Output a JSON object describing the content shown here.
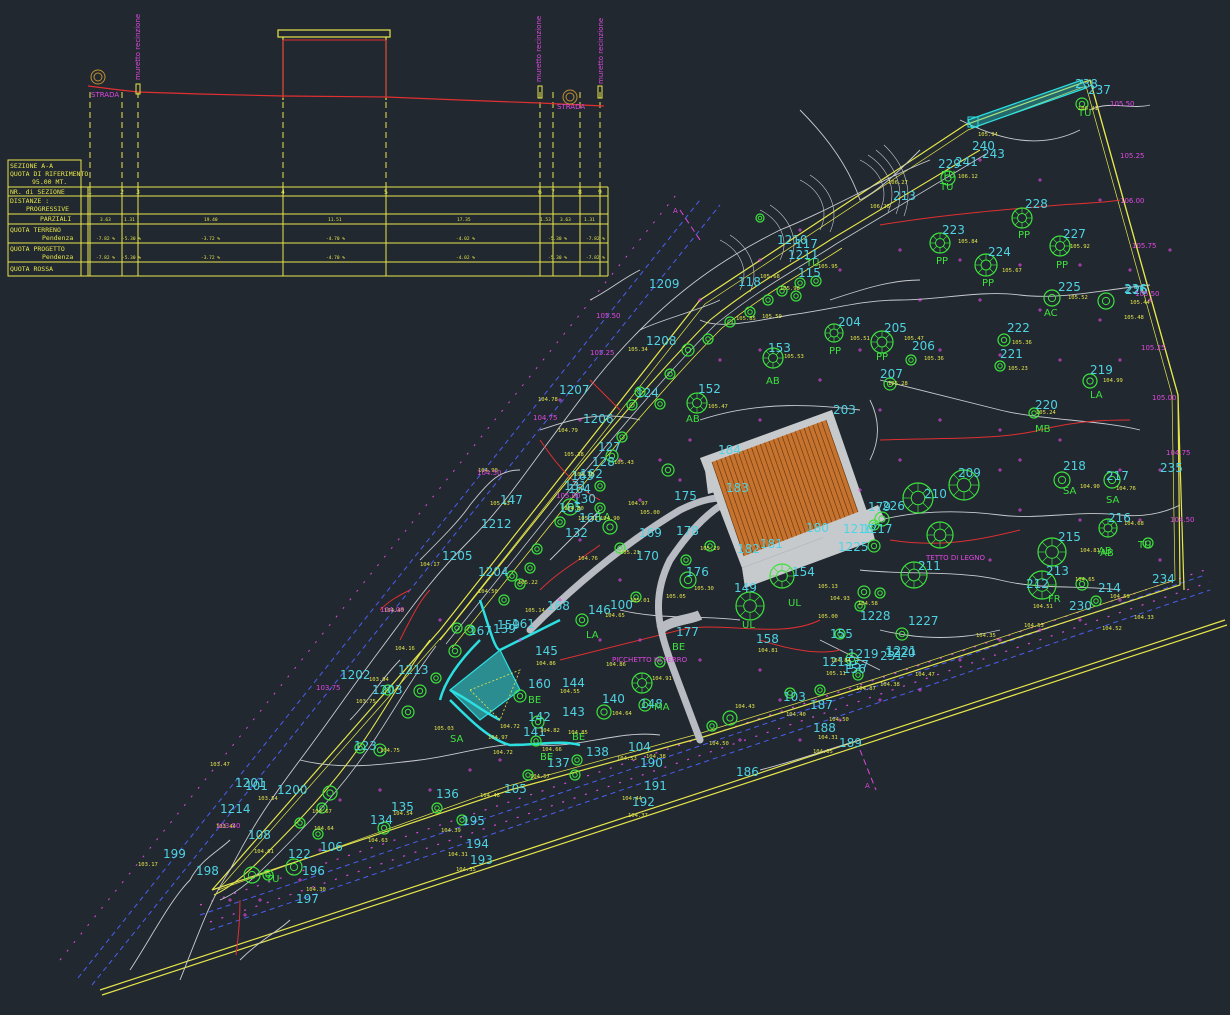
{
  "colors": {
    "background": "#212830",
    "yellow": "#e6e64a",
    "cyan": "#4fd3e3",
    "green": "#3ee23e",
    "magenta": "#e048e0",
    "red": "#e03030",
    "blue": "#4b5ef0",
    "gray": "#c9ccd0",
    "building": "#c5732e"
  },
  "section": {
    "table_rows": [
      "SEZIONE A-A",
      "QUOTA DI RIFERIMENTO",
      "95.00 MT.",
      "NR. di SEZIONE",
      "DISTANZE :",
      "PROGRESSIVE",
      "PARZIALI",
      "QUOTA TERRENO",
      "Pendenza",
      "QUOTA PROGETTO",
      "Pendenza",
      "QUOTA ROSSA"
    ],
    "section_numbers": [
      "1",
      "2",
      "3",
      "4",
      "5",
      "6",
      "7",
      "8",
      "9"
    ],
    "labels_top": [
      "muretto recinzione",
      "muretto recinzione",
      "muretto recinzione"
    ],
    "strada_labels": [
      "STRADA",
      "STRADA"
    ],
    "partial_distances": [
      "3.63",
      "1.31",
      "19.40",
      "11.51",
      "17.35",
      "1.53",
      "3.63",
      "1.31"
    ],
    "slopes_terrain": [
      "-7.82 %",
      "-5.30 %",
      "-3.72 %",
      "-4.70 %",
      "-4.02 %",
      "-5.30 %",
      "-7.82 %"
    ],
    "slopes_project": [
      "-7.82 %",
      "-5.30 %",
      "-3.72 %",
      "-4.70 %",
      "-4.02 %",
      "-5.30 %",
      "-7.82 %"
    ]
  },
  "plan": {
    "point_labels": [
      {
        "t": "238"
      },
      {
        "t": "237"
      },
      {
        "t": "240"
      },
      {
        "t": "241"
      },
      {
        "t": "229"
      },
      {
        "t": "243"
      },
      {
        "t": "213"
      },
      {
        "t": "228"
      },
      {
        "t": "223"
      },
      {
        "t": "227"
      },
      {
        "t": "224"
      },
      {
        "t": "225"
      },
      {
        "t": "226"
      },
      {
        "t": "222"
      },
      {
        "t": "221"
      },
      {
        "t": "204"
      },
      {
        "t": "205"
      },
      {
        "t": "206"
      },
      {
        "t": "207"
      },
      {
        "t": "219"
      },
      {
        "t": "220"
      },
      {
        "t": "203"
      },
      {
        "t": "153"
      },
      {
        "t": "152"
      },
      {
        "t": "1210"
      },
      {
        "t": "1211"
      },
      {
        "t": "1209"
      },
      {
        "t": "1208"
      },
      {
        "t": "1207"
      },
      {
        "t": "1206"
      },
      {
        "t": "1212"
      },
      {
        "t": "1205"
      },
      {
        "t": "1204"
      },
      {
        "t": "1203"
      },
      {
        "t": "1202"
      },
      {
        "t": "1201"
      },
      {
        "t": "1200"
      },
      {
        "t": "1214"
      },
      {
        "t": "1213"
      },
      {
        "t": "218"
      },
      {
        "t": "217"
      },
      {
        "t": "216"
      },
      {
        "t": "215"
      },
      {
        "t": "213"
      },
      {
        "t": "214"
      },
      {
        "t": "212"
      },
      {
        "t": "230"
      },
      {
        "t": "231"
      },
      {
        "t": "234"
      },
      {
        "t": "235"
      },
      {
        "t": "209"
      },
      {
        "t": "210"
      },
      {
        "t": "211"
      },
      {
        "t": "226"
      },
      {
        "t": "1227"
      },
      {
        "t": "1228"
      },
      {
        "t": "1219"
      },
      {
        "t": "1220"
      },
      {
        "t": "1221"
      },
      {
        "t": "1215"
      },
      {
        "t": "1216"
      },
      {
        "t": "1217"
      },
      {
        "t": "1225"
      },
      {
        "t": "180"
      },
      {
        "t": "181"
      },
      {
        "t": "182"
      },
      {
        "t": "183"
      },
      {
        "t": "184"
      },
      {
        "t": "178"
      },
      {
        "t": "177"
      },
      {
        "t": "176"
      },
      {
        "t": "175"
      },
      {
        "t": "170"
      },
      {
        "t": "169"
      },
      {
        "t": "168"
      },
      {
        "t": "167"
      },
      {
        "t": "166"
      },
      {
        "t": "165"
      },
      {
        "t": "164"
      },
      {
        "t": "163"
      },
      {
        "t": "162"
      },
      {
        "t": "161"
      },
      {
        "t": "160"
      },
      {
        "t": "159"
      },
      {
        "t": "158"
      },
      {
        "t": "155"
      },
      {
        "t": "154"
      },
      {
        "t": "149"
      },
      {
        "t": "148"
      },
      {
        "t": "147"
      },
      {
        "t": "146"
      },
      {
        "t": "145"
      },
      {
        "t": "144"
      },
      {
        "t": "143"
      },
      {
        "t": "142"
      },
      {
        "t": "141"
      },
      {
        "t": "140"
      },
      {
        "t": "139"
      },
      {
        "t": "138"
      },
      {
        "t": "137"
      },
      {
        "t": "136"
      },
      {
        "t": "135"
      },
      {
        "t": "134"
      },
      {
        "t": "132"
      },
      {
        "t": "131"
      },
      {
        "t": "130"
      },
      {
        "t": "128"
      },
      {
        "t": "127"
      },
      {
        "t": "124"
      },
      {
        "t": "123"
      },
      {
        "t": "122"
      },
      {
        "t": "118"
      },
      {
        "t": "117"
      },
      {
        "t": "115"
      },
      {
        "t": "108"
      },
      {
        "t": "106"
      },
      {
        "t": "105"
      },
      {
        "t": "104"
      },
      {
        "t": "100"
      },
      {
        "t": "199"
      },
      {
        "t": "198"
      },
      {
        "t": "197"
      },
      {
        "t": "196"
      },
      {
        "t": "195"
      },
      {
        "t": "194"
      },
      {
        "t": "193"
      },
      {
        "t": "192"
      },
      {
        "t": "191"
      },
      {
        "t": "190"
      },
      {
        "t": "189"
      },
      {
        "t": "188"
      },
      {
        "t": "187"
      },
      {
        "t": "186"
      },
      {
        "t": "156"
      },
      {
        "t": "157"
      },
      {
        "t": "179"
      },
      {
        "t": "236"
      },
      {
        "t": "103"
      },
      {
        "t": "101"
      }
    ],
    "species_labels": [
      {
        "t": "TU"
      },
      {
        "t": "TU"
      },
      {
        "t": "PP"
      },
      {
        "t": "PP"
      },
      {
        "t": "PP"
      },
      {
        "t": "PP"
      },
      {
        "t": "AC"
      },
      {
        "t": "AB"
      },
      {
        "t": "PP"
      },
      {
        "t": "PP"
      },
      {
        "t": "AB"
      },
      {
        "t": "AB"
      },
      {
        "t": "LA"
      },
      {
        "t": "MB"
      },
      {
        "t": "SA"
      },
      {
        "t": "SA"
      },
      {
        "t": "AB"
      },
      {
        "t": "TU"
      },
      {
        "t": "LA"
      },
      {
        "t": "LA"
      },
      {
        "t": "BE"
      },
      {
        "t": "BE"
      },
      {
        "t": "MA"
      },
      {
        "t": "SA"
      },
      {
        "t": "BE"
      },
      {
        "t": "TU"
      },
      {
        "t": "TU"
      },
      {
        "t": "UL"
      },
      {
        "t": "UL"
      },
      {
        "t": "FR"
      },
      {
        "t": "BE"
      },
      {
        "t": "TU"
      }
    ],
    "elevation_labels": [
      {
        "t": "106.41"
      },
      {
        "t": "105.94"
      },
      {
        "t": "106.12"
      },
      {
        "t": "106.27"
      },
      {
        "t": "106.26"
      },
      {
        "t": "105.95"
      },
      {
        "t": "105.84"
      },
      {
        "t": "105.92"
      },
      {
        "t": "105.67"
      },
      {
        "t": "105.52"
      },
      {
        "t": "105.48"
      },
      {
        "t": "105.44"
      },
      {
        "t": "105.36"
      },
      {
        "t": "105.23"
      },
      {
        "t": "105.51"
      },
      {
        "t": "105.47"
      },
      {
        "t": "105.36"
      },
      {
        "t": "105.28"
      },
      {
        "t": "104.99"
      },
      {
        "t": "105.24"
      },
      {
        "t": "105.53"
      },
      {
        "t": "105.47"
      },
      {
        "t": "105.98"
      },
      {
        "t": "105.85"
      },
      {
        "t": "105.68"
      },
      {
        "t": "105.59"
      },
      {
        "t": "105.34"
      },
      {
        "t": "104.79"
      },
      {
        "t": "105.38"
      },
      {
        "t": "105.43"
      },
      {
        "t": "104.78"
      },
      {
        "t": "104.17"
      },
      {
        "t": "104.90"
      },
      {
        "t": "104.50"
      },
      {
        "t": "104.40"
      },
      {
        "t": "104.16"
      },
      {
        "t": "103.94"
      },
      {
        "t": "103.75"
      },
      {
        "t": "103.47"
      },
      {
        "t": "103.54"
      },
      {
        "t": "103.44"
      },
      {
        "t": "103.17"
      },
      {
        "t": "104.90"
      },
      {
        "t": "104.76"
      },
      {
        "t": "104.68"
      },
      {
        "t": "104.81"
      },
      {
        "t": "104.65"
      },
      {
        "t": "104.59"
      },
      {
        "t": "104.53"
      },
      {
        "t": "104.35"
      },
      {
        "t": "104.47"
      },
      {
        "t": "104.38"
      },
      {
        "t": "104.52"
      },
      {
        "t": "104.58"
      },
      {
        "t": "104.93"
      },
      {
        "t": "104.81"
      },
      {
        "t": "105.13"
      },
      {
        "t": "105.30"
      },
      {
        "t": "105.29"
      },
      {
        "t": "105.21"
      },
      {
        "t": "105.05"
      },
      {
        "t": "105.01"
      },
      {
        "t": "104.91"
      },
      {
        "t": "104.86"
      },
      {
        "t": "104.55"
      },
      {
        "t": "104.64"
      },
      {
        "t": "104.86"
      },
      {
        "t": "104.82"
      },
      {
        "t": "104.85"
      },
      {
        "t": "104.66"
      },
      {
        "t": "104.57"
      },
      {
        "t": "104.53"
      },
      {
        "t": "104.46"
      },
      {
        "t": "104.39"
      },
      {
        "t": "104.31"
      },
      {
        "t": "104.35"
      },
      {
        "t": "104.30"
      },
      {
        "t": "104.38"
      },
      {
        "t": "104.44"
      },
      {
        "t": "104.37"
      },
      {
        "t": "104.50"
      },
      {
        "t": "104.05"
      },
      {
        "t": "104.31"
      },
      {
        "t": "104.43"
      },
      {
        "t": "104.40"
      },
      {
        "t": "104.50"
      },
      {
        "t": "104.84"
      },
      {
        "t": "105.11"
      },
      {
        "t": "105.00"
      },
      {
        "t": "104.87"
      },
      {
        "t": "104.72"
      },
      {
        "t": "104.75"
      },
      {
        "t": "105.03"
      },
      {
        "t": "104.65"
      },
      {
        "t": "104.97"
      },
      {
        "t": "104.67"
      },
      {
        "t": "104.64"
      },
      {
        "t": "104.61"
      },
      {
        "t": "104.63"
      },
      {
        "t": "104.54"
      },
      {
        "t": "104.33"
      },
      {
        "t": "104.51"
      },
      {
        "t": "104.80"
      },
      {
        "t": "104.78"
      },
      {
        "t": "104.90"
      },
      {
        "t": "105.13"
      },
      {
        "t": "105.22"
      },
      {
        "t": "105.14"
      },
      {
        "t": "105.32"
      },
      {
        "t": "104.72"
      },
      {
        "t": "104.76"
      },
      {
        "t": "104.97"
      },
      {
        "t": "105.00"
      }
    ],
    "magenta_labels": [
      {
        "t": "105.50"
      },
      {
        "t": "105.25"
      },
      {
        "t": "106.00"
      },
      {
        "t": "105.75"
      },
      {
        "t": "105.50"
      },
      {
        "t": "105.25"
      },
      {
        "t": "105.00"
      },
      {
        "t": "104.75"
      },
      {
        "t": "104.50"
      },
      {
        "t": "105.50"
      },
      {
        "t": "105.25"
      },
      {
        "t": "105.00"
      },
      {
        "t": "104.75"
      },
      {
        "t": "104.50"
      },
      {
        "t": "104.00"
      },
      {
        "t": "103.75"
      },
      {
        "t": "103.50"
      },
      {
        "t": "TETTO DI LEGNO"
      },
      {
        "t": "PICCHETTO IN FERRO"
      },
      {
        "t": "A"
      },
      {
        "t": "A"
      }
    ]
  }
}
